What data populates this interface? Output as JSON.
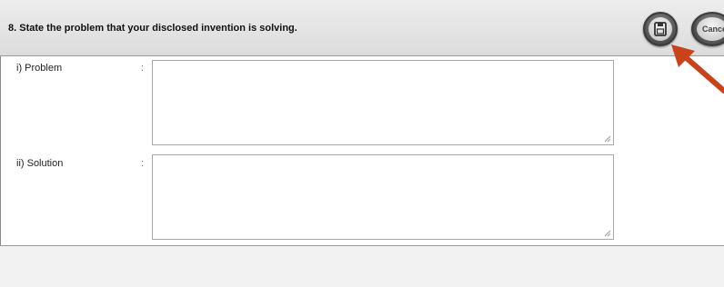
{
  "form": {
    "question": "8. State the problem that your disclosed invention is solving.",
    "rows": [
      {
        "label": "i) Problem",
        "separator": ":",
        "value": ""
      },
      {
        "label": "ii) Solution",
        "separator": ":",
        "value": ""
      }
    ]
  },
  "toolbar": {
    "save_icon": "floppy-disk-icon",
    "cancel_label": "Cancel"
  },
  "annotation": {
    "arrow_color": "#c8431a",
    "arrow_icon": "pointer-arrow"
  }
}
